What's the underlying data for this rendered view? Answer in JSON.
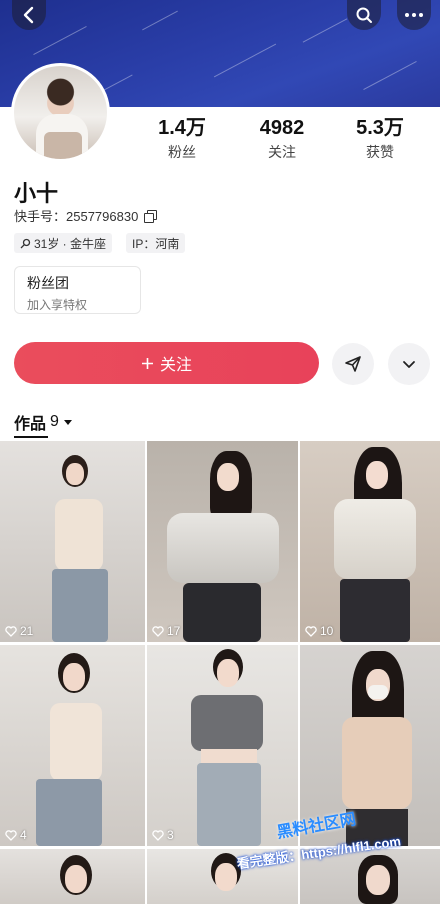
{
  "profile": {
    "name": "小十",
    "kuaishou_id": "快手号：2557796830",
    "tags": {
      "age": "31岁 · 金牛座",
      "ip": "IP：河南"
    }
  },
  "stats": [
    {
      "value": "1.4万",
      "label": "粉丝"
    },
    {
      "value": "4982",
      "label": "关注"
    },
    {
      "value": "5.3万",
      "label": "获赞"
    }
  ],
  "fan_club": {
    "title": "粉丝团",
    "subtitle": "加入享特权"
  },
  "actions": {
    "follow_label": "关注"
  },
  "works": {
    "label": "作品",
    "count": "9"
  },
  "posts": [
    {
      "likes": "21"
    },
    {
      "likes": "17"
    },
    {
      "likes": "10"
    },
    {
      "likes": "4"
    },
    {
      "likes": "3"
    },
    {
      "likes": ""
    },
    {
      "likes": ""
    },
    {
      "likes": ""
    },
    {
      "likes": ""
    }
  ],
  "watermark": {
    "line1": "黑料社区网",
    "line2": "看完整版：https://hlfl1.com"
  },
  "colors": {
    "accent": "#e8465c",
    "header": "#2a3ea8"
  },
  "icons": {
    "back": "chevron-left-icon",
    "search": "search-icon",
    "more": "more-dots-icon",
    "share": "send-icon",
    "dropdown": "chevron-down-icon"
  }
}
